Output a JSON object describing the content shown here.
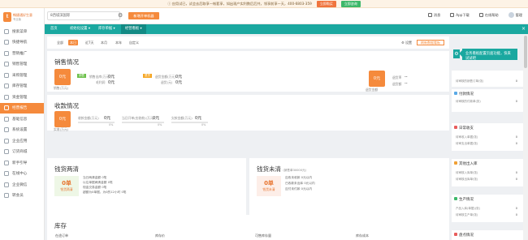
{
  "notice": {
    "text": "ⓘ 应用试已，试会去后取享一帐套享，如出现产实利数后后共，领享前享一天，400-6803-359",
    "btn_buy": "立即购买",
    "btn_consult": "立即咨询"
  },
  "logo": {
    "mark": "t",
    "name": "畅捷通好生意",
    "sub": "专业版"
  },
  "sidebar": {
    "items": [
      {
        "label": "搜索菜单"
      },
      {
        "label": "快捷导航"
      },
      {
        "label": "营销推广"
      },
      {
        "label": "销售管理"
      },
      {
        "label": "采购管理"
      },
      {
        "label": "库存管理"
      },
      {
        "label": "资金管理"
      },
      {
        "label": "经营报告"
      },
      {
        "label": "基础信息"
      },
      {
        "label": "系统设置"
      },
      {
        "label": "企业应用"
      },
      {
        "label": "订货商城"
      },
      {
        "label": "新手引导"
      },
      {
        "label": "在线中心"
      },
      {
        "label": "企业微信"
      },
      {
        "label": "转会员"
      }
    ]
  },
  "topbar": {
    "search_value": "8西城滨国际",
    "create_button": "新增开单机器",
    "links": [
      {
        "label": "消息"
      },
      {
        "label": "App下载"
      },
      {
        "label": "在线帮助"
      },
      {
        "label": "管理"
      }
    ]
  },
  "tabs": [
    {
      "label": "首页"
    },
    {
      "label": "初始化设置 ▾"
    },
    {
      "label": "库存单据 ▾"
    },
    {
      "label": "经营看板 ▾"
    }
  ],
  "tab_close": "×",
  "filter": {
    "chips": [
      {
        "label": "全部"
      },
      {
        "label": "本日"
      },
      {
        "label": "近7天"
      },
      {
        "label": "本月"
      },
      {
        "label": "本年"
      },
      {
        "label": "自定义"
      }
    ],
    "settings": "⚙ 设置",
    "refresh": "刷新数据看板"
  },
  "sales": {
    "title": "销售情况",
    "total_value": "0元",
    "total_label": "销售(万元)",
    "tag_green": "销售",
    "c1_label": "销售出库(万元)",
    "c1_value": "0元",
    "c1_sub": "毛利润",
    "c1_sub_value": "0元",
    "tag_orange": "退货",
    "c2_label": "退货金额(万元)",
    "c2_value": "0元",
    "c2_sub": "退货(元)",
    "c2_sub_value": "0元",
    "right_value": "0元",
    "right_label": "退货金额",
    "right_sub1": "退货率",
    "right_sub1_value": "--",
    "right_sub2": "退货额",
    "right_sub2_value": "--"
  },
  "collection": {
    "title": "收款情况",
    "total_value": "0元",
    "total_label": "实收(万元)",
    "items": [
      {
        "label": "收款金额(万元)",
        "value": "0元",
        "pct": "0%"
      },
      {
        "label": "当日开单(应收款)(万元)",
        "value": "0元",
        "pct": "0%"
      },
      {
        "label": "欠款金额(万元)",
        "value": "0元",
        "pct": "0%"
      }
    ]
  },
  "cashflow": {
    "title": "钱货两清",
    "num": "0单",
    "sub": "钱货两清",
    "rows": [
      {
        "label": "当日两清金额",
        "value": "0笔"
      },
      {
        "label": "以往单据两清金额",
        "value": "0笔"
      },
      {
        "label": "现金交易金额",
        "value": "0笔"
      },
      {
        "label": "超额为0单据，为0的12小时",
        "value": "0笔"
      }
    ]
  },
  "unsettled": {
    "title": "钱货未清",
    "title_note": "(销售单30000元)",
    "num": "0单",
    "sub": "钱货未清",
    "rows": [
      {
        "label": "应收未收款",
        "value": "0元以内"
      },
      {
        "label": "已收款未出库",
        "value": "0元以内"
      },
      {
        "label": "应付未付款",
        "value": "0元以内"
      }
    ]
  },
  "inventory": {
    "title": "库存",
    "headers": [
      {
        "label": "在途订单"
      },
      {
        "label": "库存价"
      },
      {
        "label": "可售库存量"
      },
      {
        "label": "库存成本"
      }
    ]
  },
  "right": {
    "popup": "业务看板配置页面功能，快来试试吧",
    "popup_gear": "⚙",
    "cards": [
      {
        "title": "",
        "rows": [
          {
            "label": "待审核的销售订单(张)",
            "value": "0"
          }
        ]
      },
      {
        "title": "付款情况",
        "rows": [
          {
            "label": "待审核的付款单(张)",
            "value": "0"
          }
        ]
      },
      {
        "title": "日常收支",
        "rows": [
          {
            "label": "待审收入单据(张)",
            "value": "0"
          },
          {
            "label": "待审支出单据(张)",
            "value": "0"
          }
        ]
      },
      {
        "title": "其他出入库",
        "rows": [
          {
            "label": "待审核入库单(张)",
            "value": "0"
          },
          {
            "label": "待审核出库单(张)",
            "value": "0"
          }
        ]
      },
      {
        "title": "生产情况",
        "rows": [
          {
            "label": "产品入库(单据)(张)",
            "value": "0"
          },
          {
            "label": "待审核生产单(张)",
            "value": "0"
          }
        ]
      },
      {
        "title": "盘点情况",
        "rows": []
      }
    ]
  },
  "colors": {
    "accent": "#f58a3c",
    "teal": "#1aa8a0",
    "green_tag": "#6cc04a",
    "orange_tag": "#f5a623"
  }
}
